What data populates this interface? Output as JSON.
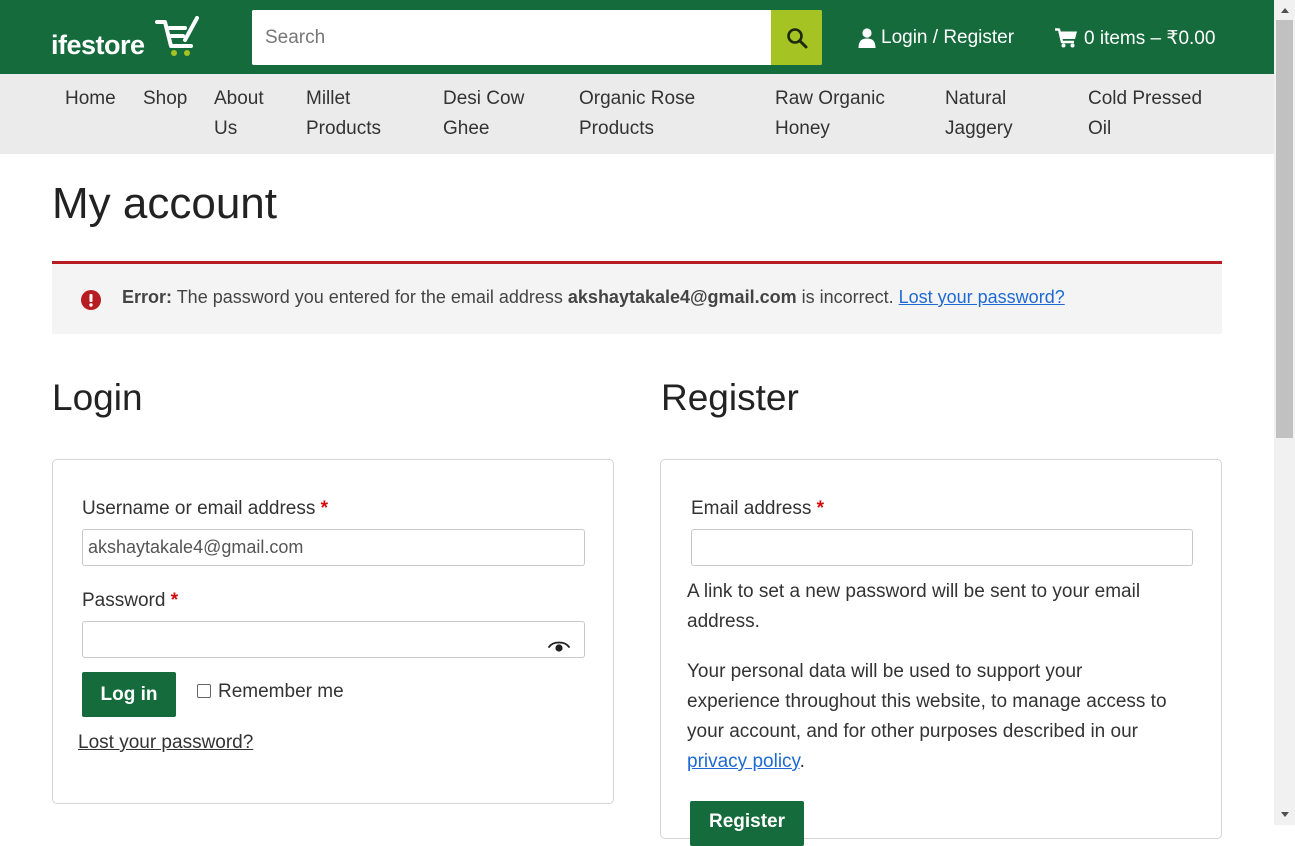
{
  "header": {
    "logo_text": "ifestore",
    "search_placeholder": "Search",
    "login_label": "Login / Register",
    "cart_label": "0 items – ₹0.00"
  },
  "nav": {
    "items": [
      {
        "line1": "Home",
        "line2": ""
      },
      {
        "line1": "Shop",
        "line2": ""
      },
      {
        "line1": "About",
        "line2": "Us"
      },
      {
        "line1": "Millet",
        "line2": "Products"
      },
      {
        "line1": "Desi Cow",
        "line2": "Ghee"
      },
      {
        "line1": "Organic Rose",
        "line2": "Products"
      },
      {
        "line1": "Raw Organic",
        "line2": "Honey"
      },
      {
        "line1": "Natural",
        "line2": "Jaggery"
      },
      {
        "line1": "Cold Pressed",
        "line2": "Oil"
      }
    ]
  },
  "page": {
    "title": "My account"
  },
  "error": {
    "prefix": "Error:",
    "message_before": " The password you entered for the email address ",
    "email": "akshaytakale4@gmail.com",
    "message_after": " is incorrect. ",
    "link": "Lost your password?"
  },
  "login": {
    "heading": "Login",
    "username_label": "Username or email address",
    "username_value": "akshaytakale4@gmail.com",
    "password_label": "Password",
    "password_value": "",
    "required_mark": "*",
    "submit_label": "Log in",
    "remember_label": "Remember me",
    "lost_password_link": "Lost your password?"
  },
  "register": {
    "heading": "Register",
    "email_label": "Email address",
    "email_value": "",
    "required_mark": "*",
    "info_line1": "A link to set a new password will be sent to your email",
    "info_line2": "address.",
    "privacy_line1": "Your personal data will be used to support your",
    "privacy_line2": "experience throughout this website, to manage access to",
    "privacy_line3": "your account, and for other purposes described in our",
    "privacy_link": "privacy policy",
    "privacy_end": ".",
    "submit_label": "Register"
  },
  "colors": {
    "brand_green": "#156b3c",
    "search_button": "#a5c424",
    "error_red": "#b81c23",
    "link_blue": "#1e6ad5"
  }
}
